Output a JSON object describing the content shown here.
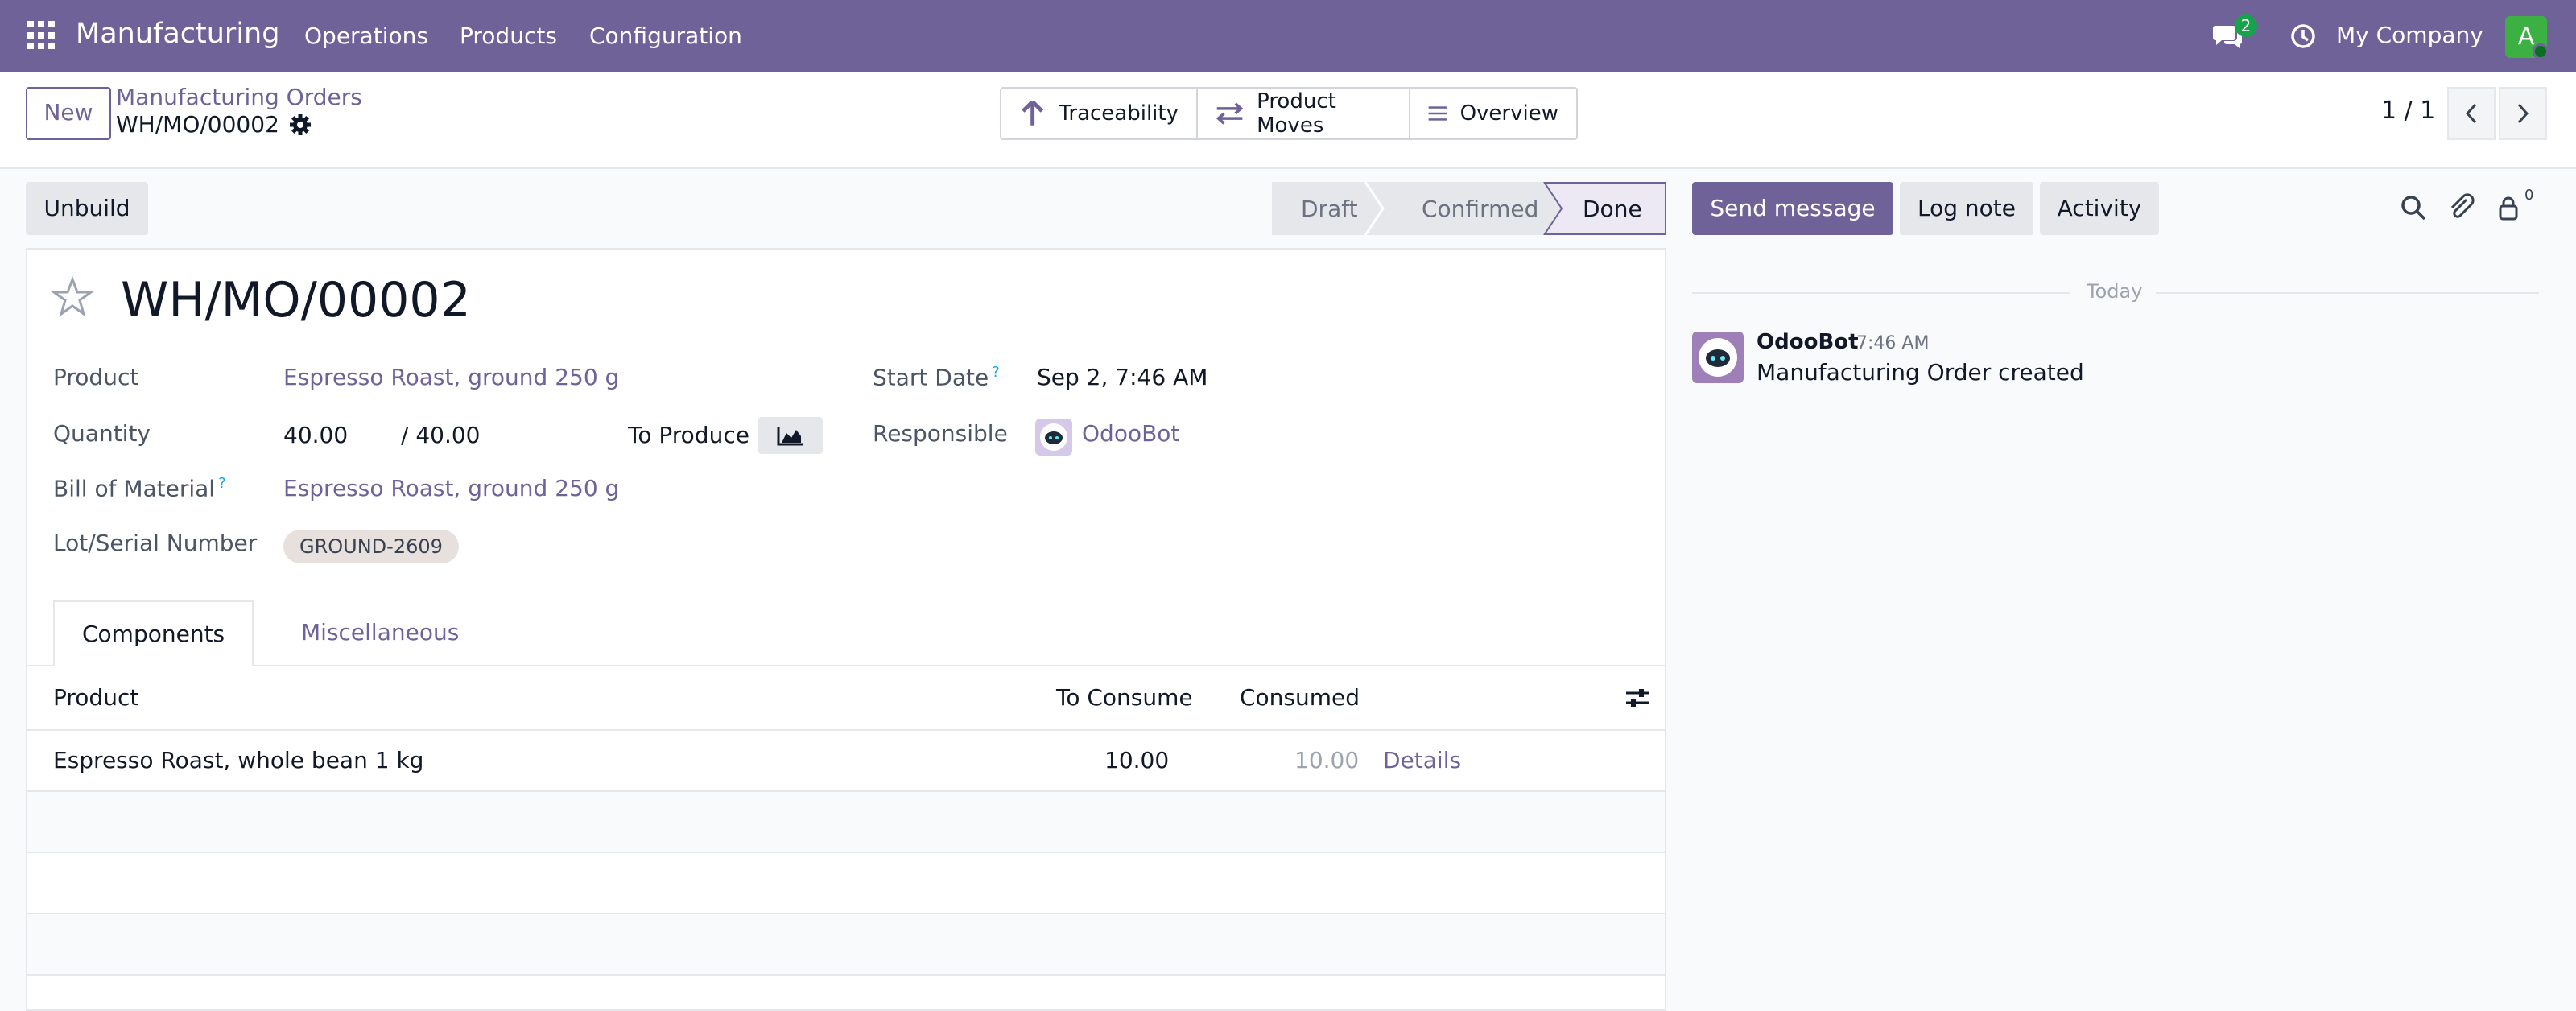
{
  "navbar": {
    "app_name": "Manufacturing",
    "menu": [
      "Operations",
      "Products",
      "Configuration"
    ],
    "chat_count": "2",
    "company": "My Company",
    "user_initial": "A"
  },
  "control_panel": {
    "new_label": "New",
    "breadcrumb_parent": "Manufacturing Orders",
    "breadcrumb_current": "WH/MO/00002",
    "smart_buttons": [
      {
        "label": "Traceability",
        "icon": "arrow-up-icon"
      },
      {
        "label": "Product Moves",
        "icon": "exchange-arrows-icon"
      },
      {
        "label": "Overview",
        "icon": "bars-icon"
      }
    ],
    "pager": "1 / 1"
  },
  "form": {
    "unbuild_label": "Unbuild",
    "stages": [
      "Draft",
      "Confirmed",
      "Done"
    ],
    "active_stage": "Done",
    "title": "WH/MO/00002",
    "fields": {
      "product_label": "Product",
      "product_value": "Espresso Roast, ground 250 g",
      "quantity_label": "Quantity",
      "quantity_value": "40.00",
      "quantity_total": "/ 40.00",
      "to_produce": "To Produce",
      "bom_label": "Bill of Material",
      "bom_help": "?",
      "bom_value": "Espresso Roast, ground 250 g",
      "lot_label": "Lot/Serial Number",
      "lot_value": "GROUND-2609",
      "start_label": "Start Date",
      "start_help": "?",
      "start_value": "Sep 2, 7:46 AM",
      "responsible_label": "Responsible",
      "responsible_value": "OdooBot"
    },
    "tabs": [
      "Components",
      "Miscellaneous"
    ],
    "table": {
      "columns": [
        "Product",
        "To Consume",
        "Consumed"
      ],
      "rows": [
        {
          "product": "Espresso Roast, whole bean 1 kg",
          "to_consume": "10.00",
          "consumed": "10.00",
          "action": "Details"
        }
      ]
    }
  },
  "chatter": {
    "send_message": "Send message",
    "log_note": "Log note",
    "activity": "Activity",
    "followers": "0",
    "date_separator": "Today",
    "message": {
      "author": "OdooBot",
      "time": "7:46 AM",
      "body": "Manufacturing Order created"
    }
  },
  "colors": {
    "brand": "#6f6299",
    "success": "#17a34a"
  }
}
